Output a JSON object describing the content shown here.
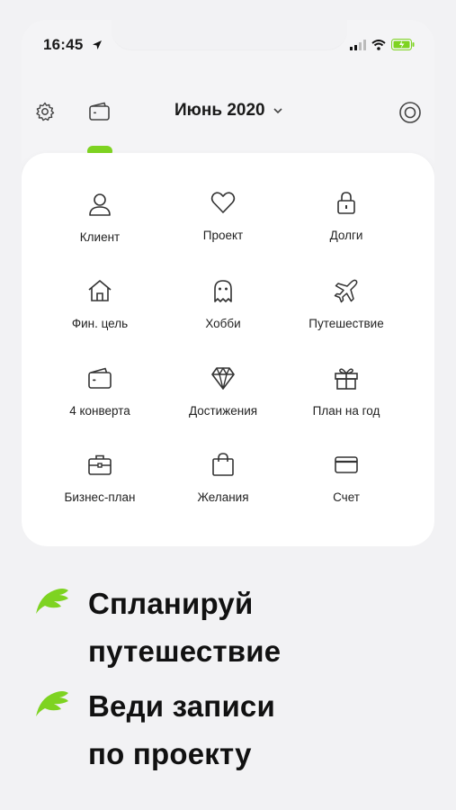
{
  "status_bar": {
    "time": "16:45"
  },
  "header": {
    "month": "Июнь 2020"
  },
  "categories": [
    {
      "label": "Клиент",
      "icon": "user-icon"
    },
    {
      "label": "Проект",
      "icon": "heart-icon"
    },
    {
      "label": "Долги",
      "icon": "lock-icon"
    },
    {
      "label": "Фин. цель",
      "icon": "house-icon"
    },
    {
      "label": "Хобби",
      "icon": "ghost-icon"
    },
    {
      "label": "Путешествие",
      "icon": "airplane-icon"
    },
    {
      "label": "4 конверта",
      "icon": "wallet-icon"
    },
    {
      "label": "Достижения",
      "icon": "diamond-icon"
    },
    {
      "label": "План на год",
      "icon": "gift-icon"
    },
    {
      "label": "Бизнес-план",
      "icon": "briefcase-icon"
    },
    {
      "label": "Желания",
      "icon": "shopping-bag-icon"
    },
    {
      "label": "Счет",
      "icon": "credit-card-icon"
    }
  ],
  "promo": [
    {
      "line1": "Спланируй",
      "line2": "путешествие"
    },
    {
      "line1": "Веди записи",
      "line2": "по проекту"
    }
  ],
  "colors": {
    "accent": "#7ed321",
    "text": "#1a1a1a"
  }
}
